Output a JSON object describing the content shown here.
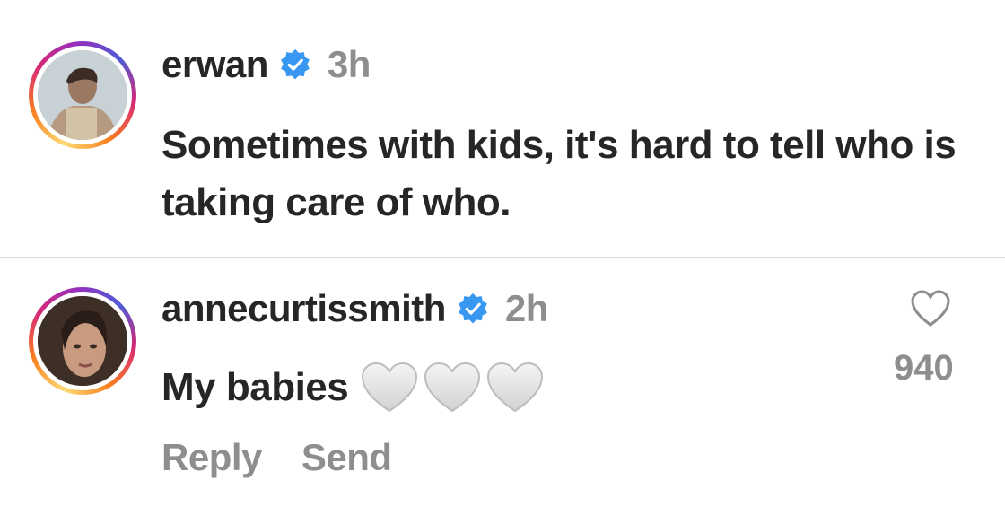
{
  "comments": [
    {
      "username": "erwan",
      "verified": true,
      "time": "3h",
      "text": "Sometimes with kids, it's hard to tell who is taking care of who."
    },
    {
      "username": "annecurtissmith",
      "verified": true,
      "time": "2h",
      "text": "My babies",
      "emoji": "white-heart-icon x3",
      "likes": "940",
      "actions": {
        "reply": "Reply",
        "send": "Send"
      }
    }
  ],
  "colors": {
    "verified": "#3897f0",
    "muted": "#8e8e8e",
    "text": "#262626",
    "divider": "#dbdbdb"
  }
}
